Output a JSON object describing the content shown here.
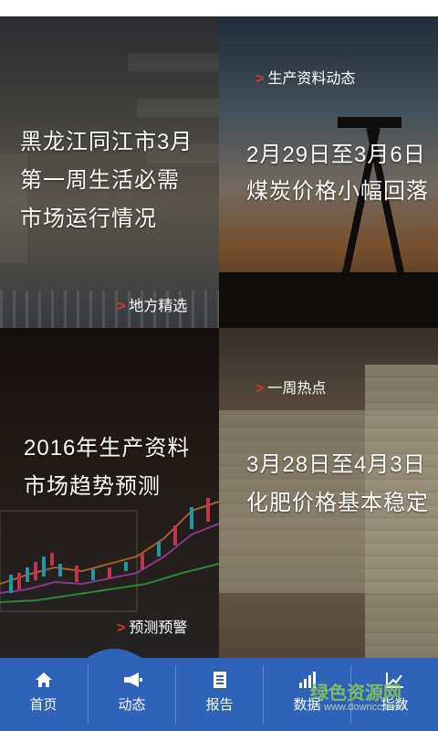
{
  "tiles": {
    "local": {
      "title_line1": "黑龙江同江市3月",
      "title_line2": "第一周生活必需",
      "title_line3": "市场运行情况",
      "tag": "地方精选"
    },
    "dynamics": {
      "tag": "生产资料动态",
      "title_line1": "2月29日至3月6日",
      "title_line2": "煤炭价格小幅回落"
    },
    "forecast": {
      "title_line1": "2016年生产资料",
      "title_line2": "市场趋势预测",
      "tag": "预测预警"
    },
    "hot": {
      "tag": "一周热点",
      "title_line1": "3月28日至4月3日",
      "title_line2": "化肥价格基本稳定"
    }
  },
  "nav": {
    "items": [
      {
        "label": "首页",
        "icon": "home-icon"
      },
      {
        "label": "动态",
        "icon": "megaphone-icon"
      },
      {
        "label": "报告",
        "icon": "report-icon"
      },
      {
        "label": "数据",
        "icon": "bar-chart-icon"
      },
      {
        "label": "指数",
        "icon": "trend-chart-icon"
      }
    ]
  },
  "watermark": {
    "text": "绿色资源网",
    "sub": "www.downcc.com"
  },
  "colors": {
    "nav_bg": "#2f63b8",
    "tag_arrow": "#e0322e"
  }
}
